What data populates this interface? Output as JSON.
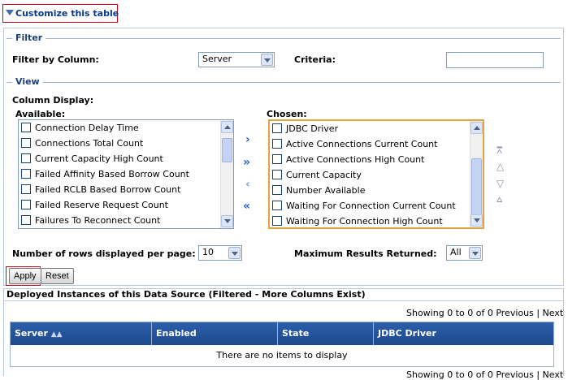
{
  "customize": {
    "label": "Customize this table"
  },
  "filter": {
    "legend": "Filter",
    "by_column_label": "Filter by Column:",
    "by_column_value": "Server",
    "criteria_label": "Criteria:",
    "criteria_value": ""
  },
  "view": {
    "legend": "View",
    "column_display_label": "Column Display:",
    "available_label": "Available:",
    "chosen_label": "Chosen:",
    "available": [
      "Connection Delay Time",
      "Connections Total Count",
      "Current Capacity High Count",
      "Failed Affinity Based Borrow Count",
      "Failed RCLB Based Borrow Count",
      "Failed Reserve Request Count",
      "Failures To Reconnect Count"
    ],
    "chosen": [
      "JDBC Driver",
      "Active Connections Current Count",
      "Active Connections High Count",
      "Current Capacity",
      "Number Available",
      "Waiting For Connection Current Count",
      "Waiting For Connection High Count"
    ],
    "move_icons": [
      "move-right-icon",
      "move-all-right-icon",
      "move-left-icon",
      "move-all-left-icon"
    ],
    "order_icons": [
      "move-top-icon",
      "move-up-icon",
      "move-down-icon",
      "move-bottom-icon"
    ],
    "rows_label": "Number of rows displayed per page:",
    "rows_value": "10",
    "max_results_label": "Maximum Results Returned:",
    "max_results_value": "All"
  },
  "buttons": {
    "apply": "Apply",
    "reset": "Reset"
  },
  "table": {
    "title": "Deployed Instances of this Data Source (Filtered - More Columns Exist)",
    "pager_text": "Showing 0 to 0 of 0",
    "previous": "Previous",
    "separator": "|",
    "next": "Next",
    "columns": [
      "Server",
      "Enabled",
      "State",
      "JDBC Driver"
    ],
    "empty_message": "There are no items to display"
  },
  "colors": {
    "header_blue": "#1e4a8e",
    "highlight_red": "#d0021b",
    "chosen_border": "#e3a33f"
  }
}
